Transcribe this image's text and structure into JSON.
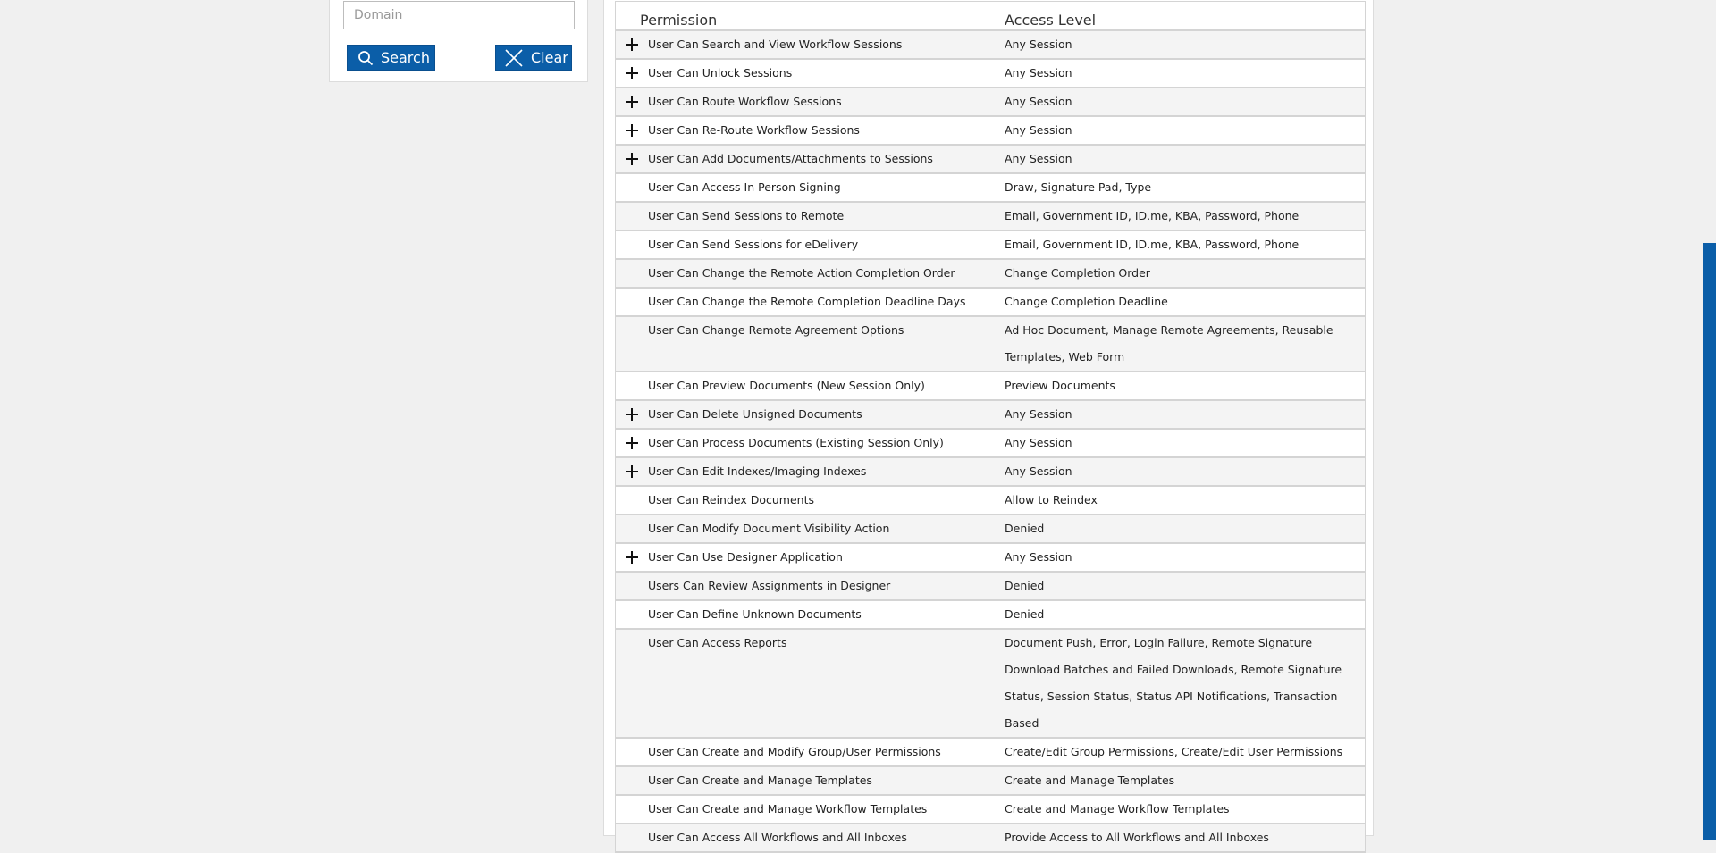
{
  "search": {
    "domain_placeholder": "Domain",
    "search_label": "Search",
    "clear_label": "Clear"
  },
  "table": {
    "headers": {
      "permission": "Permission",
      "access_level": "Access Level"
    },
    "rows": [
      {
        "permission": "User Can Search and View Workflow Sessions",
        "access": "Any Session",
        "expandable": true
      },
      {
        "permission": "User Can Unlock Sessions",
        "access": "Any Session",
        "expandable": true
      },
      {
        "permission": "User Can Route Workflow Sessions",
        "access": "Any Session",
        "expandable": true
      },
      {
        "permission": "User Can Re-Route Workflow Sessions",
        "access": "Any Session",
        "expandable": true
      },
      {
        "permission": "User Can Add Documents/Attachments to Sessions",
        "access": "Any Session",
        "expandable": true
      },
      {
        "permission": "User Can Access In Person Signing",
        "access": "Draw, Signature Pad, Type",
        "expandable": false
      },
      {
        "permission": "User Can Send Sessions to Remote",
        "access": "Email, Government ID, ID.me, KBA, Password, Phone",
        "expandable": false
      },
      {
        "permission": "User Can Send Sessions for eDelivery",
        "access": "Email, Government ID, ID.me, KBA, Password, Phone",
        "expandable": false
      },
      {
        "permission": "User Can Change the Remote Action Completion Order",
        "access": "Change Completion Order",
        "expandable": false
      },
      {
        "permission": "User Can Change the Remote Completion Deadline Days",
        "access": "Change Completion Deadline",
        "expandable": false
      },
      {
        "permission": "User Can Change Remote Agreement Options",
        "access": "Ad Hoc Document, Manage Remote Agreements, Reusable Templates, Web Form",
        "expandable": false
      },
      {
        "permission": "User Can Preview Documents (New Session Only)",
        "access": "Preview Documents",
        "expandable": false
      },
      {
        "permission": "User Can Delete Unsigned Documents",
        "access": "Any Session",
        "expandable": true
      },
      {
        "permission": "User Can Process Documents (Existing Session Only)",
        "access": "Any Session",
        "expandable": true
      },
      {
        "permission": "User Can Edit Indexes/Imaging Indexes",
        "access": "Any Session",
        "expandable": true
      },
      {
        "permission": "User Can Reindex Documents",
        "access": "Allow to Reindex",
        "expandable": false
      },
      {
        "permission": "User Can Modify Document Visibility Action",
        "access": "Denied",
        "expandable": false
      },
      {
        "permission": "User Can Use Designer Application",
        "access": "Any Session",
        "expandable": true
      },
      {
        "permission": "Users Can Review Assignments in Designer",
        "access": "Denied",
        "expandable": false
      },
      {
        "permission": "User Can Define Unknown Documents",
        "access": "Denied",
        "expandable": false
      },
      {
        "permission": "User Can Access Reports",
        "access": "Document Push, Error, Login Failure, Remote Signature Download Batches and Failed Downloads, Remote Signature Status, Session Status, Status API Notifications, Transaction Based",
        "expandable": false
      },
      {
        "permission": "User Can Create and Modify Group/User Permissions",
        "access": "Create/Edit Group Permissions, Create/Edit User Permissions",
        "expandable": false
      },
      {
        "permission": "User Can Create and Manage Templates",
        "access": "Create and Manage Templates",
        "expandable": false
      },
      {
        "permission": "User Can Create and Manage Workflow Templates",
        "access": "Create and Manage Workflow Templates",
        "expandable": false
      },
      {
        "permission": "User Can Access All Workflows and All Inboxes",
        "access": "Provide Access to All Workflows and All Inboxes",
        "expandable": false
      }
    ]
  },
  "colors": {
    "accent": "#0b5ea8",
    "row_alt": "#f4f4f4",
    "border": "#d4d4d4"
  },
  "icons": {
    "search": "magnifier-icon",
    "clear": "close-x-icon",
    "expand": "plus-icon"
  }
}
